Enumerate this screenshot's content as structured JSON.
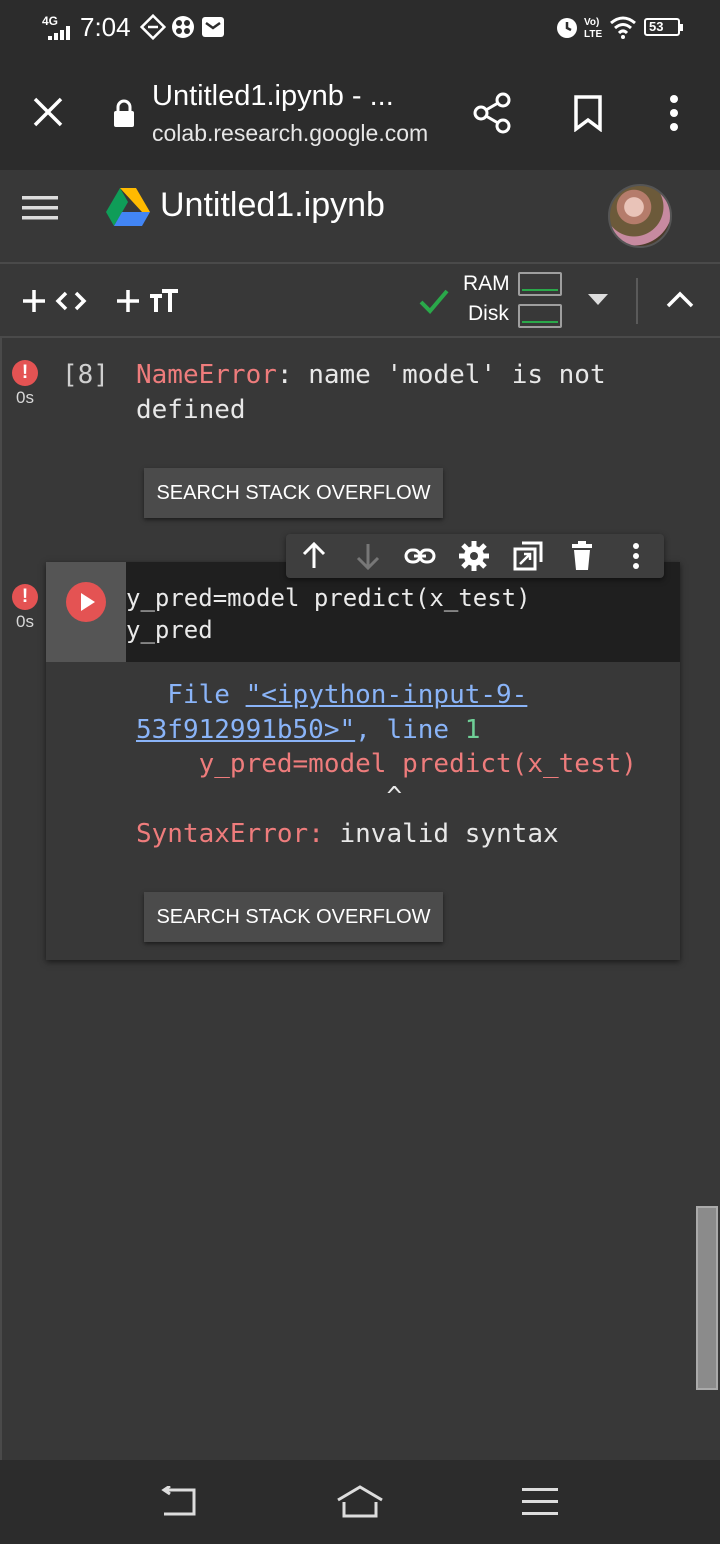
{
  "status_bar": {
    "network": "4G",
    "time": "7:04",
    "battery": "53",
    "icons": [
      "signal-icon",
      "vpn-icon",
      "app-icon",
      "mail-icon",
      "alarm-icon",
      "volte-icon",
      "wifi-icon",
      "battery-icon"
    ]
  },
  "browser": {
    "tab_title": "Untitled1.ipynb - ...",
    "url": "colab.research.google.com"
  },
  "colab": {
    "notebook_title": "Untitled1.ipynb",
    "ram_label": "RAM",
    "disk_label": "Disk"
  },
  "cells": [
    {
      "exec_count": "[8]",
      "runtime": "0s",
      "error_name": "NameError",
      "error_msg": ": name 'model' is not defined",
      "button_label": "SEARCH STACK OVERFLOW"
    },
    {
      "runtime": "0s",
      "code_line1": "y_pred=model predict(x_test)",
      "code_line2": "y_pred",
      "tb_file": "  File ",
      "tb_link": "\"<ipython-input-9-53f912991b50>\"",
      "tb_line_label": ", line ",
      "tb_line_num": "1",
      "tb_code": "    y_pred=model predict(x_test)",
      "tb_caret": "                ^",
      "error_name": "SyntaxError",
      "error_sep": ":",
      "error_msg": " invalid syntax",
      "button_label": "SEARCH STACK OVERFLOW"
    }
  ],
  "colors": {
    "accent_red": "#e45353",
    "check_green": "#2aa84a",
    "link_blue": "#8ab4f8"
  }
}
